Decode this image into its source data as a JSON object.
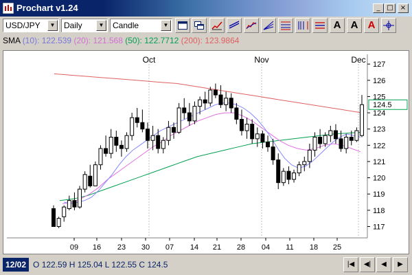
{
  "window": {
    "title": "Prochart v1.24",
    "minimize": "_",
    "maximize": "□",
    "close": "×"
  },
  "toolbar": {
    "symbol": "USD/JPY",
    "period": "Daily",
    "chart_style": "Candle"
  },
  "sma": {
    "label": "SMA",
    "p10": "(10):",
    "v10": "122.539",
    "p20": "(20):",
    "v20": "121.568",
    "p50": "(50):",
    "v50": "122.7712",
    "p200": "(200):",
    "v200": "123.9864"
  },
  "colors": {
    "sma10": "#8888ff",
    "sma20": "#e070e0",
    "sma50": "#00a050",
    "sma200": "#e06060"
  },
  "chart_data": {
    "type": "candlestick",
    "symbol": "USD/JPY",
    "x_ticks": [
      "09",
      "16",
      "23",
      "30",
      "07",
      "14",
      "21",
      "28",
      "04",
      "11",
      "18",
      "25"
    ],
    "month_labels": [
      "Oct",
      "Nov",
      "Dec"
    ],
    "y_ticks": [
      "117",
      "118",
      "119",
      "120",
      "121",
      "122",
      "123",
      "124",
      "125",
      "126",
      "127"
    ],
    "ylim": [
      116.3,
      127.6
    ],
    "last_price": "124.5",
    "candles": [
      [
        118.1,
        118.3,
        117.0,
        117.0
      ],
      [
        117.0,
        117.6,
        116.9,
        117.5
      ],
      [
        117.6,
        118.3,
        117.3,
        118.2
      ],
      [
        118.1,
        118.9,
        118.0,
        118.6
      ],
      [
        118.6,
        119.1,
        118.0,
        118.2
      ],
      [
        118.2,
        119.5,
        118.1,
        119.3
      ],
      [
        119.3,
        120.4,
        119.1,
        120.2
      ],
      [
        120.1,
        120.8,
        119.4,
        119.5
      ],
      [
        119.5,
        121.0,
        119.5,
        120.8
      ],
      [
        120.8,
        122.0,
        120.5,
        121.8
      ],
      [
        121.8,
        122.6,
        121.3,
        121.5
      ],
      [
        121.5,
        123.0,
        121.2,
        122.5
      ],
      [
        122.5,
        122.9,
        121.6,
        122.0
      ],
      [
        122.0,
        122.3,
        121.3,
        121.8
      ],
      [
        121.8,
        122.8,
        121.6,
        122.6
      ],
      [
        122.6,
        124.0,
        122.3,
        123.7
      ],
      [
        123.7,
        124.3,
        123.1,
        123.4
      ],
      [
        123.4,
        124.2,
        122.8,
        123.0
      ],
      [
        123.0,
        123.4,
        121.8,
        122.3
      ],
      [
        122.3,
        123.2,
        121.7,
        122.6
      ],
      [
        122.6,
        123.0,
        121.5,
        121.8
      ],
      [
        121.8,
        122.5,
        121.5,
        122.3
      ],
      [
        122.3,
        123.5,
        122.0,
        123.1
      ],
      [
        123.1,
        123.4,
        122.4,
        122.8
      ],
      [
        122.8,
        124.6,
        122.7,
        124.3
      ],
      [
        124.3,
        124.9,
        123.6,
        124.0
      ],
      [
        124.0,
        124.6,
        123.2,
        123.5
      ],
      [
        123.5,
        124.7,
        123.3,
        124.4
      ],
      [
        124.4,
        125.0,
        123.9,
        124.8
      ],
      [
        124.8,
        125.3,
        124.2,
        124.6
      ],
      [
        124.6,
        125.6,
        124.4,
        125.4
      ],
      [
        125.4,
        125.8,
        124.9,
        125.1
      ],
      [
        125.1,
        125.7,
        124.3,
        124.5
      ],
      [
        124.5,
        125.3,
        124.1,
        124.9
      ],
      [
        124.9,
        125.2,
        124.0,
        124.3
      ],
      [
        124.3,
        124.6,
        123.3,
        123.6
      ],
      [
        123.6,
        124.2,
        122.6,
        122.9
      ],
      [
        122.9,
        123.7,
        122.4,
        123.3
      ],
      [
        123.3,
        123.6,
        122.1,
        122.4
      ],
      [
        122.4,
        123.1,
        121.9,
        122.7
      ],
      [
        122.7,
        122.9,
        121.8,
        122.2
      ],
      [
        122.2,
        122.6,
        121.6,
        121.9
      ],
      [
        121.9,
        122.4,
        120.8,
        121.1
      ],
      [
        121.1,
        121.5,
        119.3,
        119.7
      ],
      [
        119.7,
        120.6,
        119.5,
        120.4
      ],
      [
        120.4,
        120.7,
        119.6,
        119.9
      ],
      [
        119.9,
        120.5,
        119.7,
        120.3
      ],
      [
        120.3,
        121.0,
        120.1,
        120.8
      ],
      [
        120.8,
        121.3,
        120.4,
        121.0
      ],
      [
        121.0,
        122.1,
        120.6,
        121.7
      ],
      [
        121.7,
        122.8,
        121.3,
        122.5
      ],
      [
        122.5,
        123.0,
        121.8,
        122.1
      ],
      [
        122.1,
        122.8,
        121.9,
        122.6
      ],
      [
        122.6,
        123.2,
        122.2,
        122.9
      ],
      [
        122.9,
        123.3,
        122.1,
        122.4
      ],
      [
        122.4,
        122.9,
        121.6,
        121.8
      ],
      [
        121.8,
        122.7,
        121.5,
        122.5
      ],
      [
        122.5,
        122.9,
        122.0,
        122.3
      ],
      [
        122.3,
        123.1,
        122.2,
        122.9
      ],
      [
        122.6,
        125.1,
        122.5,
        124.5
      ]
    ],
    "sma10": [
      118.5,
      118.4,
      118.5,
      118.6,
      118.8,
      119.2,
      119.7,
      120.2,
      120.8,
      121.3,
      121.7,
      122.0,
      122.3,
      122.6,
      122.9,
      123.1,
      123.3,
      123.5,
      123.7,
      123.9,
      124.1,
      124.3,
      124.5,
      124.6,
      124.6,
      124.5,
      124.3,
      124.0,
      123.6,
      123.1,
      122.5,
      121.8,
      121.2,
      120.8,
      120.6,
      120.7,
      121.0,
      121.4,
      121.8,
      122.2,
      122.5,
      122.7,
      122.6,
      122.5
    ],
    "sma20": [
      118.4,
      118.5,
      118.7,
      119.0,
      119.4,
      119.9,
      120.3,
      120.7,
      121.1,
      121.5,
      121.9,
      122.2,
      122.6,
      122.9,
      123.2,
      123.5,
      123.7,
      123.9,
      124.0,
      124.0,
      123.8,
      123.5,
      123.1,
      122.7,
      122.3,
      122.0,
      121.8,
      121.7,
      121.8,
      122.0,
      122.1,
      122.0,
      121.8,
      121.6
    ],
    "sma50": [
      118.6,
      118.7,
      118.9,
      119.2,
      119.5,
      119.8,
      120.1,
      120.4,
      120.7,
      121.0,
      121.3,
      121.5,
      121.7,
      121.9,
      122.1,
      122.2,
      122.3,
      122.4,
      122.5,
      122.6,
      122.7,
      122.75,
      122.8
    ],
    "sma200": [
      126.4,
      126.3,
      126.2,
      126.1,
      126.0,
      125.9,
      125.8,
      125.6,
      125.4,
      125.2,
      125.0,
      124.8,
      124.6,
      124.4,
      124.2,
      124.0
    ]
  },
  "status": {
    "date": "12/02",
    "o_label": "O",
    "o_val": "122.59",
    "h_label": "H",
    "h_val": "125.04",
    "l_label": "L",
    "l_val": "122.55",
    "c_label": "C",
    "c_val": "124.5"
  },
  "nav": {
    "first": "|◀",
    "prev_page": "◀|",
    "prev": "◀",
    "next": "▶"
  }
}
